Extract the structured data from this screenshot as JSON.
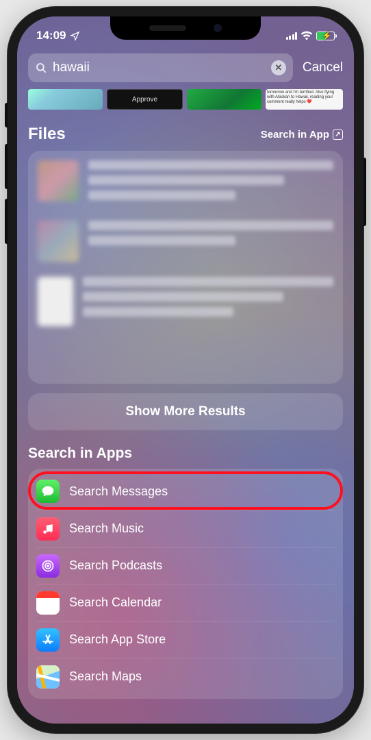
{
  "status": {
    "time": "14:09"
  },
  "search": {
    "query": "hawaii",
    "cancel": "Cancel"
  },
  "strip": {
    "approve": "Approve",
    "snippet": "tomorrow and I'm terrified. Also flying with Alaskan to Hawaii, reading your comment really helps ❤️"
  },
  "files": {
    "title": "Files",
    "open_in_app": "Search in App"
  },
  "show_more": "Show More Results",
  "apps_section": {
    "title": "Search in Apps"
  },
  "apps": [
    {
      "label": "Search Messages"
    },
    {
      "label": "Search Music"
    },
    {
      "label": "Search Podcasts"
    },
    {
      "label": "Search Calendar"
    },
    {
      "label": "Search App Store"
    },
    {
      "label": "Search Maps"
    }
  ]
}
